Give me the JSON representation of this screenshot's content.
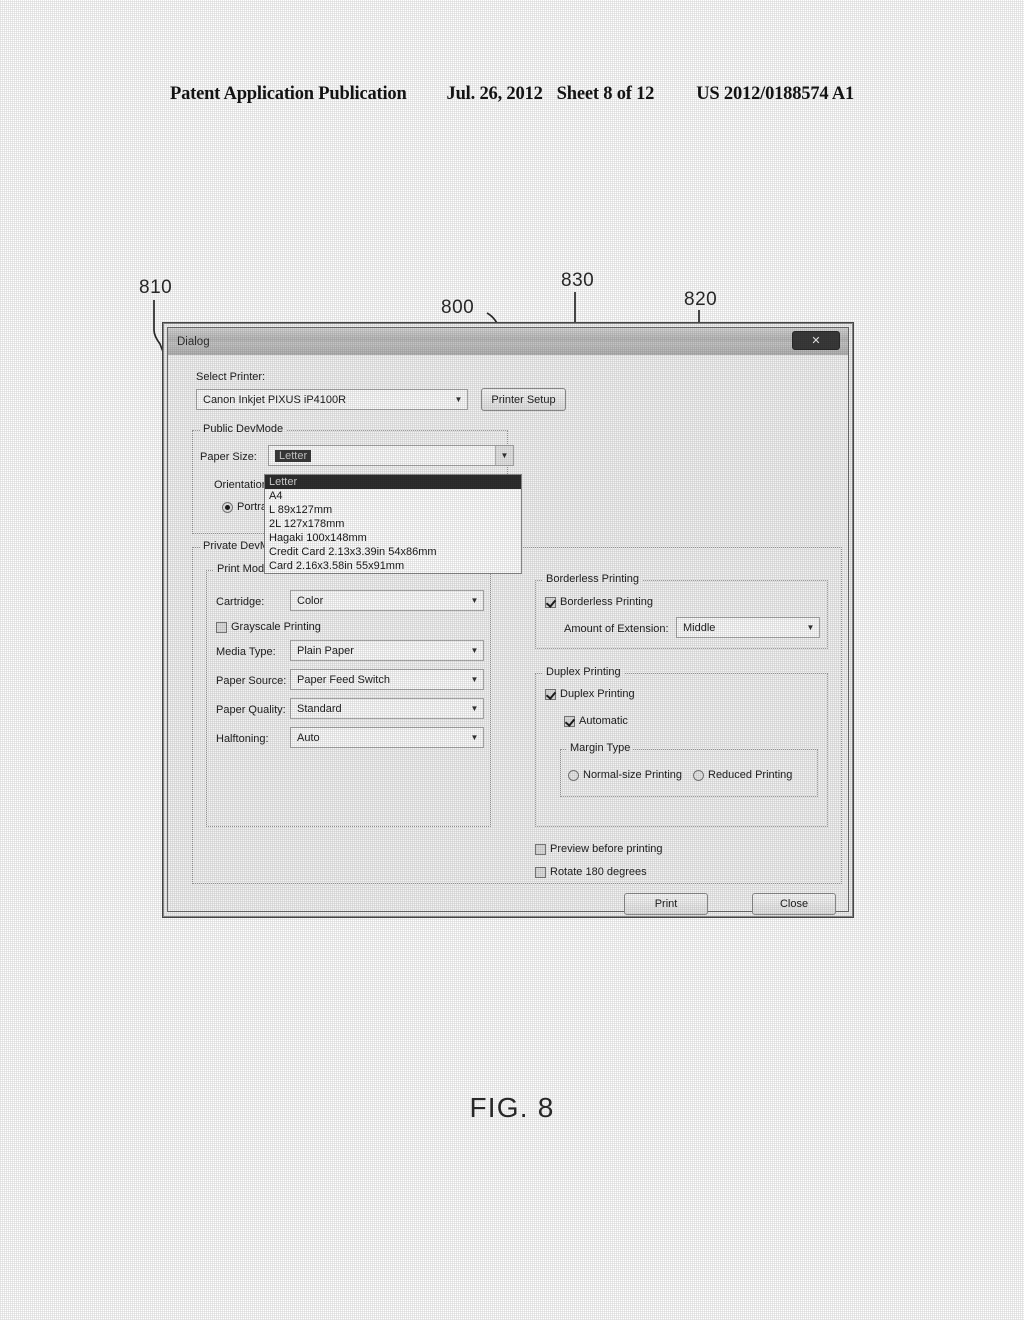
{
  "page_header": {
    "publication": "Patent Application Publication",
    "date": "Jul. 26, 2012",
    "sheet": "Sheet 8 of 12",
    "number": "US 2012/0188574 A1"
  },
  "figure_label": "FIG. 8",
  "callouts": [
    {
      "id": "810",
      "label": "810"
    },
    {
      "id": "800",
      "label": "800"
    },
    {
      "id": "830",
      "label": "830"
    },
    {
      "id": "820",
      "label": "820"
    }
  ],
  "dialog": {
    "title": "Dialog",
    "center_caption": "",
    "close_label": "✕",
    "printer": {
      "label": "Select Printer:",
      "value": "Canon Inkjet PIXUS iP4100R",
      "setup_button": "Printer Setup"
    },
    "public_devmode": {
      "title": "Public DevMode",
      "paper_size_label": "Paper Size:",
      "paper_size_value": "Letter",
      "orientation_label": "Orientation",
      "orientation_options": [
        {
          "label": "Portrait",
          "selected": true
        }
      ],
      "paper_size_options": [
        {
          "label": "Letter",
          "selected": true
        },
        {
          "label": "A4",
          "selected": false
        },
        {
          "label": "L 89x127mm",
          "selected": false
        },
        {
          "label": "2L  127x178mm",
          "selected": false
        },
        {
          "label": "Hagaki 100x148mm",
          "selected": false
        },
        {
          "label": "Credit Card 2.13x3.39in 54x86mm",
          "selected": false
        },
        {
          "label": "Card 2.16x3.58in 55x91mm",
          "selected": false
        }
      ]
    },
    "private_devmode": {
      "title": "Private DevMode",
      "print_mode": {
        "title": "Print Mode",
        "cartridge_label": "Cartridge:",
        "cartridge_value": "Color",
        "grayscale_label": "Grayscale Printing",
        "grayscale_checked": false,
        "media_type_label": "Media Type:",
        "media_type_value": "Plain Paper",
        "paper_source_label": "Paper Source:",
        "paper_source_value": "Paper Feed Switch",
        "paper_quality_label": "Paper Quality:",
        "paper_quality_value": "Standard",
        "halftoning_label": "Halftoning:",
        "halftoning_value": "Auto"
      },
      "borderless": {
        "title": "Borderless Printing",
        "checkbox_label": "Borderless Printing",
        "checkbox_checked": true,
        "extension_label": "Amount of Extension:",
        "extension_value": "Middle"
      },
      "duplex": {
        "title": "Duplex Printing",
        "checkbox_label": "Duplex Printing",
        "checkbox_checked": true,
        "automatic_label": "Automatic",
        "automatic_checked": true,
        "margin_type_title": "Margin Type",
        "margin_options": [
          {
            "label": "Normal-size Printing",
            "selected": false
          },
          {
            "label": "Reduced Printing",
            "selected": false
          }
        ]
      },
      "preview_label": "Preview before printing",
      "preview_checked": false,
      "rotate_label": "Rotate 180 degrees",
      "rotate_checked": false
    },
    "footer": {
      "print_button": "Print",
      "close_button": "Close"
    }
  }
}
